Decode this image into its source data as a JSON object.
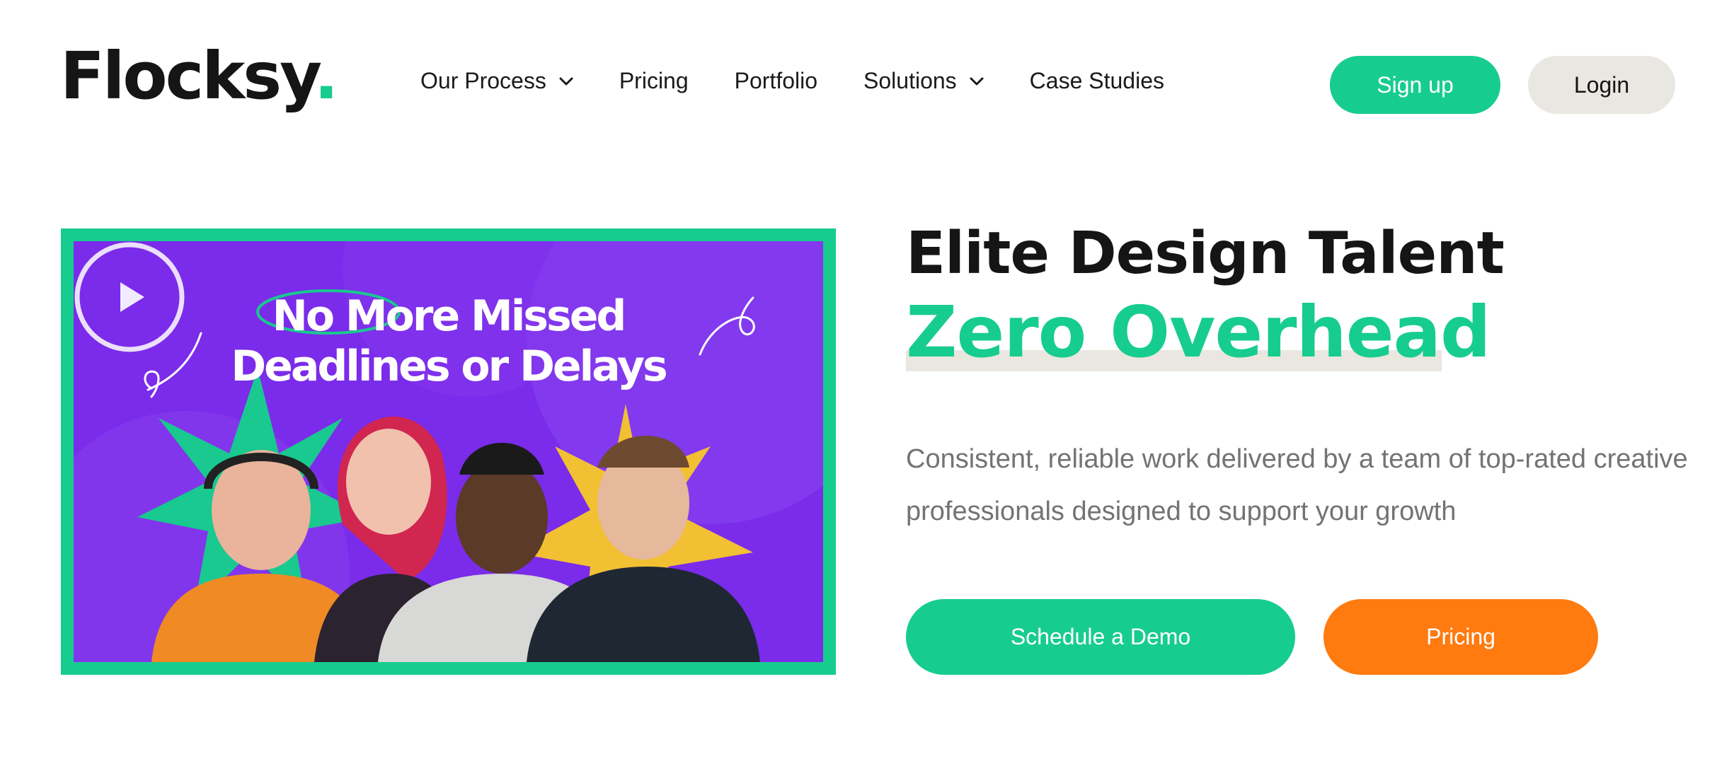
{
  "header": {
    "logo_text": "Flocksy",
    "logo_dot": ".",
    "nav": [
      {
        "label": "Our Process",
        "has_dropdown": true
      },
      {
        "label": "Pricing",
        "has_dropdown": false
      },
      {
        "label": "Portfolio",
        "has_dropdown": false
      },
      {
        "label": "Solutions",
        "has_dropdown": true
      },
      {
        "label": "Case Studies",
        "has_dropdown": false
      }
    ],
    "signup_label": "Sign up",
    "login_label": "Login"
  },
  "video": {
    "title_line1": "No More Missed",
    "title_line2": "Deadlines or Delays",
    "play_icon": "play-icon"
  },
  "hero": {
    "title": "Elite Design Talent",
    "subtitle": "Zero Overhead",
    "description": "Consistent, reliable work delivered by a team of top-rated creative professionals designed to support your growth",
    "cta_demo": "Schedule a Demo",
    "cta_pricing": "Pricing"
  },
  "colors": {
    "brand_green": "#17cc8f",
    "accent_orange": "#ff7a0f",
    "video_purple": "#7b2bea",
    "login_bg": "#e9e7e1",
    "text_dark": "#151515",
    "text_muted": "#737373"
  }
}
